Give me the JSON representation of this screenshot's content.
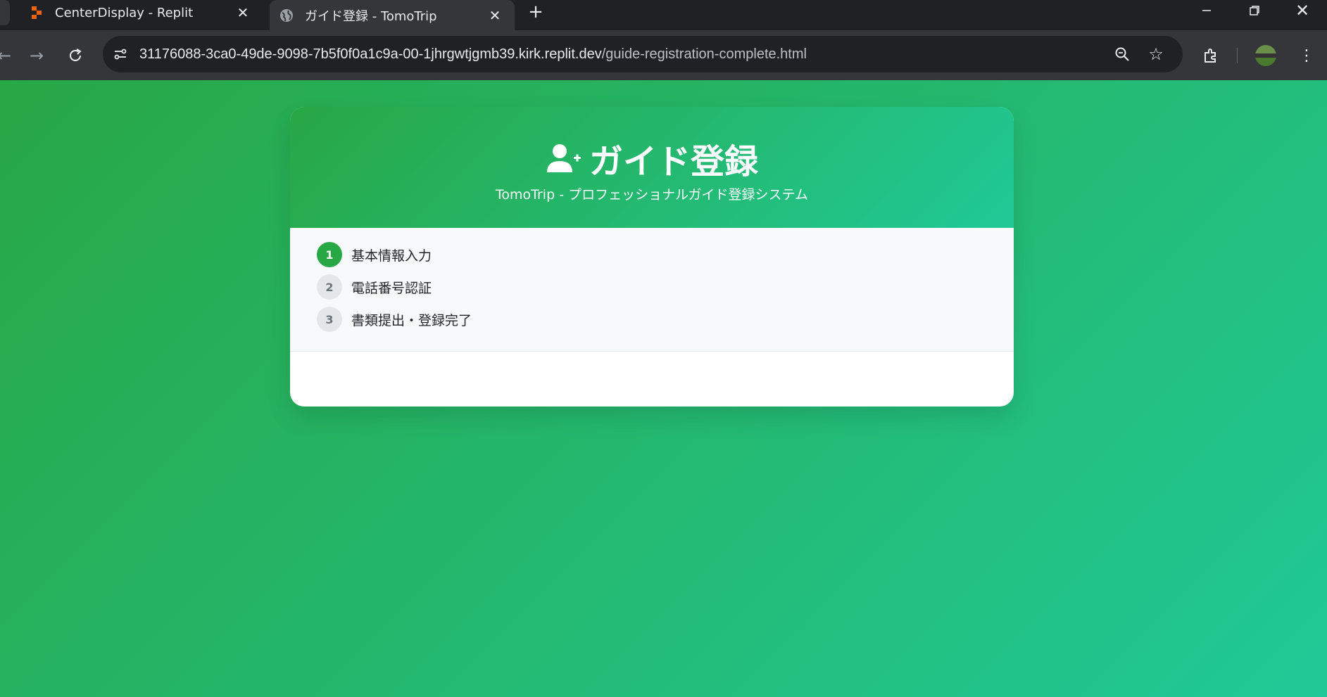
{
  "browser": {
    "tabs": [
      {
        "title": "CenterDisplay - Replit",
        "favicon": "replit-icon",
        "active": false
      },
      {
        "title": "ガイド登録 - TomoTrip",
        "favicon": "globe-icon",
        "active": true
      }
    ],
    "url": {
      "host": "31176088-3ca0-49de-9098-7b5f0f0a1c9a-00-1jhrgwtjgmb39.kirk.replit.dev",
      "path": "/guide-registration-complete.html"
    }
  },
  "page": {
    "title": "ガイド登録",
    "subtitle": "TomoTrip - プロフェッショナルガイド登録システム",
    "steps": [
      {
        "number": "1",
        "label": "基本情報入力",
        "state": "active"
      },
      {
        "number": "2",
        "label": "電話番号認証",
        "state": "pending"
      },
      {
        "number": "3",
        "label": "書類提出・登録完了",
        "state": "pending"
      }
    ]
  },
  "colors": {
    "accent": "#28a745",
    "accent_end": "#20c997"
  }
}
